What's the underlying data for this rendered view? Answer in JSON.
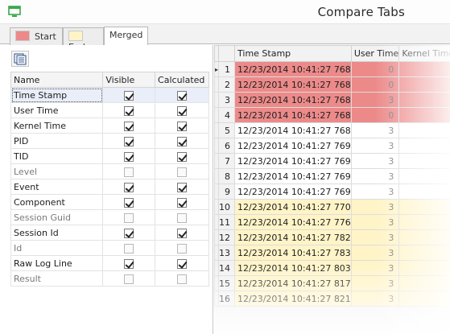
{
  "window": {
    "title": "Compare Tabs"
  },
  "tabs": [
    {
      "label": "Start",
      "color": "#ec8a8a"
    },
    {
      "label": "End",
      "color": "#fff4c7"
    },
    {
      "label": "Merged"
    }
  ],
  "columns_grid": {
    "headers": {
      "name": "Name",
      "visible": "Visible",
      "calculated": "Calculated"
    },
    "rows": [
      {
        "name": "Time Stamp",
        "visible": true,
        "calculated": true
      },
      {
        "name": "User Time",
        "visible": true,
        "calculated": true
      },
      {
        "name": "Kernel Time",
        "visible": true,
        "calculated": true
      },
      {
        "name": "PID",
        "visible": true,
        "calculated": true
      },
      {
        "name": "TID",
        "visible": true,
        "calculated": true
      },
      {
        "name": "Level",
        "visible": false,
        "calculated": false
      },
      {
        "name": "Event",
        "visible": true,
        "calculated": true
      },
      {
        "name": "Component",
        "visible": true,
        "calculated": true
      },
      {
        "name": "Session Guid",
        "visible": false,
        "calculated": false
      },
      {
        "name": "Session Id",
        "visible": true,
        "calculated": true
      },
      {
        "name": "Id",
        "visible": false,
        "calculated": false
      },
      {
        "name": "Raw Log Line",
        "visible": true,
        "calculated": true
      },
      {
        "name": "Result",
        "visible": false,
        "calculated": false
      }
    ]
  },
  "data_grid": {
    "headers": {
      "timestamp": "Time Stamp",
      "user_time": "User Time",
      "kernel_time": "Kernel Time"
    },
    "rows": [
      {
        "num": "1",
        "timestamp": "12/23/2014 10:41:27 768",
        "user_time": "0",
        "color": "red"
      },
      {
        "num": "2",
        "timestamp": "12/23/2014 10:41:27 768",
        "user_time": "0",
        "color": "red"
      },
      {
        "num": "3",
        "timestamp": "12/23/2014 10:41:27 768",
        "user_time": "3",
        "color": "red"
      },
      {
        "num": "4",
        "timestamp": "12/23/2014 10:41:27 768",
        "user_time": "0",
        "color": "red"
      },
      {
        "num": "5",
        "timestamp": "12/23/2014 10:41:27 768",
        "user_time": "3",
        "color": "white"
      },
      {
        "num": "6",
        "timestamp": "12/23/2014 10:41:27 769",
        "user_time": "3",
        "color": "white"
      },
      {
        "num": "7",
        "timestamp": "12/23/2014 10:41:27 769",
        "user_time": "3",
        "color": "white"
      },
      {
        "num": "8",
        "timestamp": "12/23/2014 10:41:27 769",
        "user_time": "3",
        "color": "white"
      },
      {
        "num": "9",
        "timestamp": "12/23/2014 10:41:27 769",
        "user_time": "3",
        "color": "white"
      },
      {
        "num": "10",
        "timestamp": "12/23/2014 10:41:27 770",
        "user_time": "3",
        "color": "yellow"
      },
      {
        "num": "11",
        "timestamp": "12/23/2014 10:41:27 776",
        "user_time": "3",
        "color": "yellow"
      },
      {
        "num": "12",
        "timestamp": "12/23/2014 10:41:27 782",
        "user_time": "3",
        "color": "yellow"
      },
      {
        "num": "13",
        "timestamp": "12/23/2014 10:41:27 783",
        "user_time": "3",
        "color": "yellow"
      },
      {
        "num": "14",
        "timestamp": "12/23/2014 10:41:27 803",
        "user_time": "3",
        "color": "yellow"
      },
      {
        "num": "15",
        "timestamp": "12/23/2014 10:41:27 817",
        "user_time": "3",
        "color": "yellow"
      },
      {
        "num": "16",
        "timestamp": "12/23/2014 10:41:27 821",
        "user_time": "3",
        "color": "yellow"
      }
    ]
  }
}
